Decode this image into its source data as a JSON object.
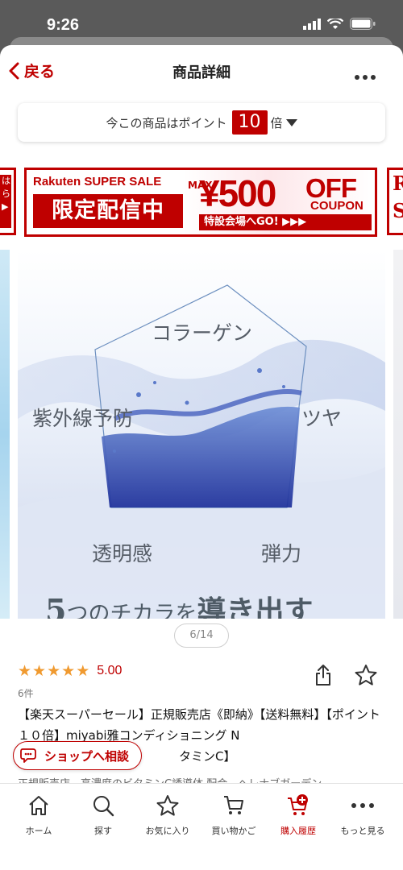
{
  "status_bar": {
    "time": "9:26"
  },
  "nav": {
    "back_label": "戻る",
    "title": "商品詳細"
  },
  "points": {
    "prefix": "今この商品はポイント",
    "multiplier": "10",
    "suffix": "倍"
  },
  "banner": {
    "sale_label": "Rakuten SUPER SALE",
    "limited_label": "限定配信中",
    "max_label": "MAX",
    "amount": "¥500",
    "off_label": "OFF",
    "coupon_label": "COUPON",
    "go_label": "特設会場へGO! ▶▶▶",
    "left_peek": "は\nら\n▶",
    "right_peek": "R\nS"
  },
  "product_image": {
    "collagen": "コラーゲン",
    "uv": "紫外線予防",
    "gloss": "ツヤ",
    "clarity": "透明感",
    "elasticity": "弾力",
    "headline_num": "5",
    "headline_mid1": "つのチカラを",
    "headline_bold": "導き出す"
  },
  "image_indicator": "6/14",
  "rating": {
    "stars": 5,
    "value": "5.00",
    "count": "6件"
  },
  "product": {
    "title": "【楽天スーパーセール】正規販売店《即納》【送料無料】【ポイント１０倍】miyabi雅コンディショニング N",
    "title_tail": "タミンC】",
    "description": "正規販売店　高濃度のビタミンC誘導体 配合　ヘレナブガーデン"
  },
  "consult_button": "ショップへ相談",
  "tabs": [
    {
      "label": "ホーム",
      "icon": "home-icon"
    },
    {
      "label": "探す",
      "icon": "search-icon"
    },
    {
      "label": "お気に入り",
      "icon": "star-icon"
    },
    {
      "label": "買い物かご",
      "icon": "cart-icon"
    },
    {
      "label": "購入履歴",
      "icon": "purchase-history-icon"
    },
    {
      "label": "もっと見る",
      "icon": "more-icon"
    }
  ],
  "colors": {
    "brand_red": "#bf0000",
    "star_orange": "#f09a30"
  }
}
